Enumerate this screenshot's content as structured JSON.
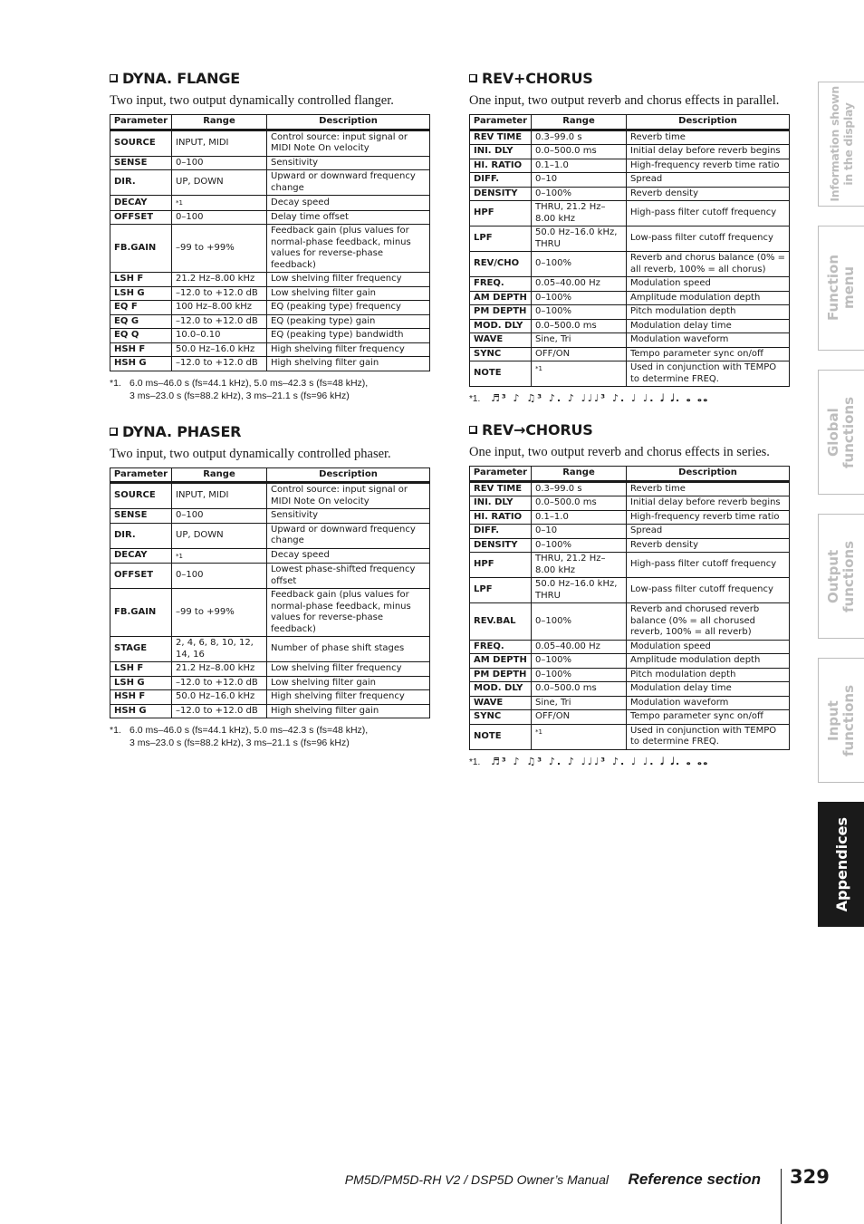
{
  "sections": {
    "dyna_flange": {
      "title": "DYNA. FLANGE",
      "description": "Two input, two output dynamically controlled flanger.",
      "headers": [
        "Parameter",
        "Range",
        "Description"
      ],
      "rows": [
        [
          "SOURCE",
          "INPUT, MIDI",
          "Control source: input signal or MIDI Note On velocity"
        ],
        [
          "SENSE",
          "0–100",
          "Sensitivity"
        ],
        [
          "DIR.",
          "UP, DOWN",
          "Upward or downward frequency change"
        ],
        [
          "DECAY",
          "*1",
          "Decay speed"
        ],
        [
          "OFFSET",
          "0–100",
          "Delay time offset"
        ],
        [
          "FB.GAIN",
          "–99 to +99%",
          "Feedback gain (plus values for normal-phase feedback, minus values for reverse-phase feedback)"
        ],
        [
          "LSH F",
          "21.2 Hz–8.00 kHz",
          "Low shelving filter frequency"
        ],
        [
          "LSH G",
          "–12.0 to +12.0 dB",
          "Low shelving filter gain"
        ],
        [
          "EQ F",
          "100 Hz–8.00 kHz",
          "EQ (peaking type) frequency"
        ],
        [
          "EQ G",
          "–12.0 to +12.0 dB",
          "EQ (peaking type) gain"
        ],
        [
          "EQ Q",
          "10.0–0.10",
          "EQ (peaking type) bandwidth"
        ],
        [
          "HSH F",
          "50.0 Hz–16.0 kHz",
          "High shelving filter frequency"
        ],
        [
          "HSH G",
          "–12.0 to +12.0 dB",
          "High shelving filter gain"
        ]
      ],
      "footnote_num": "*1.",
      "footnote_line1": "6.0 ms–46.0 s (fs=44.1 kHz), 5.0 ms–42.3 s (fs=48 kHz),",
      "footnote_line2": "3 ms–23.0 s (fs=88.2 kHz), 3 ms–21.1 s (fs=96 kHz)"
    },
    "dyna_phaser": {
      "title": "DYNA. PHASER",
      "description": "Two input, two output dynamically controlled phaser.",
      "headers": [
        "Parameter",
        "Range",
        "Description"
      ],
      "rows": [
        [
          "SOURCE",
          "INPUT, MIDI",
          "Control source: input signal or MIDI Note On velocity"
        ],
        [
          "SENSE",
          "0–100",
          "Sensitivity"
        ],
        [
          "DIR.",
          "UP, DOWN",
          "Upward or downward frequency change"
        ],
        [
          "DECAY",
          "*1",
          "Decay speed"
        ],
        [
          "OFFSET",
          "0–100",
          "Lowest phase-shifted frequency offset"
        ],
        [
          "FB.GAIN",
          "–99 to +99%",
          "Feedback gain (plus values for normal-phase feedback, minus values for reverse-phase feedback)"
        ],
        [
          "STAGE",
          "2, 4, 6, 8, 10, 12, 14, 16",
          "Number of phase shift stages"
        ],
        [
          "LSH F",
          "21.2 Hz–8.00 kHz",
          "Low shelving filter frequency"
        ],
        [
          "LSH G",
          "–12.0 to +12.0 dB",
          "Low shelving filter gain"
        ],
        [
          "HSH F",
          "50.0 Hz–16.0 kHz",
          "High shelving filter frequency"
        ],
        [
          "HSH G",
          "–12.0 to +12.0 dB",
          "High shelving filter gain"
        ]
      ],
      "footnote_num": "*1.",
      "footnote_line1": "6.0 ms–46.0 s (fs=44.1 kHz), 5.0 ms–42.3 s (fs=48 kHz),",
      "footnote_line2": "3 ms–23.0 s (fs=88.2 kHz), 3 ms–21.1 s (fs=96 kHz)"
    },
    "rev_plus_chorus": {
      "title": "REV+CHORUS",
      "description": "One input, two output reverb and chorus effects in parallel.",
      "headers": [
        "Parameter",
        "Range",
        "Description"
      ],
      "rows": [
        [
          "REV TIME",
          "0.3–99.0 s",
          "Reverb time"
        ],
        [
          "INI. DLY",
          "0.0–500.0 ms",
          "Initial delay before reverb begins"
        ],
        [
          "HI. RATIO",
          "0.1–1.0",
          "High-frequency reverb time ratio"
        ],
        [
          "DIFF.",
          "0–10",
          "Spread"
        ],
        [
          "DENSITY",
          "0–100%",
          "Reverb density"
        ],
        [
          "HPF",
          "THRU, 21.2 Hz–8.00 kHz",
          "High-pass filter cutoff frequency"
        ],
        [
          "LPF",
          "50.0 Hz–16.0 kHz, THRU",
          "Low-pass filter cutoff frequency"
        ],
        [
          "REV/CHO",
          "0–100%",
          "Reverb and chorus balance (0% = all reverb, 100% = all chorus)"
        ],
        [
          "FREQ.",
          "0.05–40.00 Hz",
          "Modulation speed"
        ],
        [
          "AM DEPTH",
          "0–100%",
          "Amplitude modulation depth"
        ],
        [
          "PM DEPTH",
          "0–100%",
          "Pitch modulation depth"
        ],
        [
          "MOD. DLY",
          "0.0–500.0 ms",
          "Modulation delay time"
        ],
        [
          "WAVE",
          "Sine, Tri",
          "Modulation waveform"
        ],
        [
          "SYNC",
          "OFF/ON",
          "Tempo parameter sync on/off"
        ],
        [
          "NOTE",
          "*1",
          "Used in conjunction with TEMPO to determine FREQ."
        ]
      ],
      "footnote_num": "*1.",
      "note_values": "♬³ ♪ ♫³ ♪. ♪ ♩♩♩³ ♪. ♩ ♩. 𝅗𝅥 𝅗𝅥. 𝅝 𝅝𝅝"
    },
    "rev_to_chorus": {
      "title": "REV→CHORUS",
      "description": "One input, two output reverb and chorus effects in series.",
      "headers": [
        "Parameter",
        "Range",
        "Description"
      ],
      "rows": [
        [
          "REV TIME",
          "0.3–99.0 s",
          "Reverb time"
        ],
        [
          "INI. DLY",
          "0.0–500.0 ms",
          "Initial delay before reverb begins"
        ],
        [
          "HI. RATIO",
          "0.1–1.0",
          "High-frequency reverb time ratio"
        ],
        [
          "DIFF.",
          "0–10",
          "Spread"
        ],
        [
          "DENSITY",
          "0–100%",
          "Reverb density"
        ],
        [
          "HPF",
          "THRU, 21.2 Hz–8.00 kHz",
          "High-pass filter cutoff frequency"
        ],
        [
          "LPF",
          "50.0 Hz–16.0 kHz, THRU",
          "Low-pass filter cutoff frequency"
        ],
        [
          "REV.BAL",
          "0–100%",
          "Reverb and chorused reverb balance (0% = all chorused reverb, 100% = all reverb)"
        ],
        [
          "FREQ.",
          "0.05–40.00 Hz",
          "Modulation speed"
        ],
        [
          "AM DEPTH",
          "0–100%",
          "Amplitude modulation depth"
        ],
        [
          "PM DEPTH",
          "0–100%",
          "Pitch modulation depth"
        ],
        [
          "MOD. DLY",
          "0.0–500.0 ms",
          "Modulation delay time"
        ],
        [
          "WAVE",
          "Sine, Tri",
          "Modulation waveform"
        ],
        [
          "SYNC",
          "OFF/ON",
          "Tempo parameter sync on/off"
        ],
        [
          "NOTE",
          "*1",
          "Used in conjunction with TEMPO to determine FREQ."
        ]
      ],
      "footnote_num": "*1.",
      "note_values": "♬³ ♪ ♫³ ♪. ♪ ♩♩♩³ ♪. ♩ ♩. 𝅗𝅥 𝅗𝅥. 𝅝 𝅝𝅝"
    }
  },
  "side_tabs": [
    {
      "label": "Information shown\nin the display",
      "active": false
    },
    {
      "label": "Function\nmenu",
      "active": false
    },
    {
      "label": "Global\nfunctions",
      "active": false
    },
    {
      "label": "Output\nfunctions",
      "active": false
    },
    {
      "label": "Input\nfunctions",
      "active": false
    },
    {
      "label": "Appendices",
      "active": true
    }
  ],
  "footer": {
    "manual_title": "PM5D/PM5D-RH V2 / DSP5D Owner’s Manual",
    "section": "Reference section",
    "page_number": "329"
  }
}
